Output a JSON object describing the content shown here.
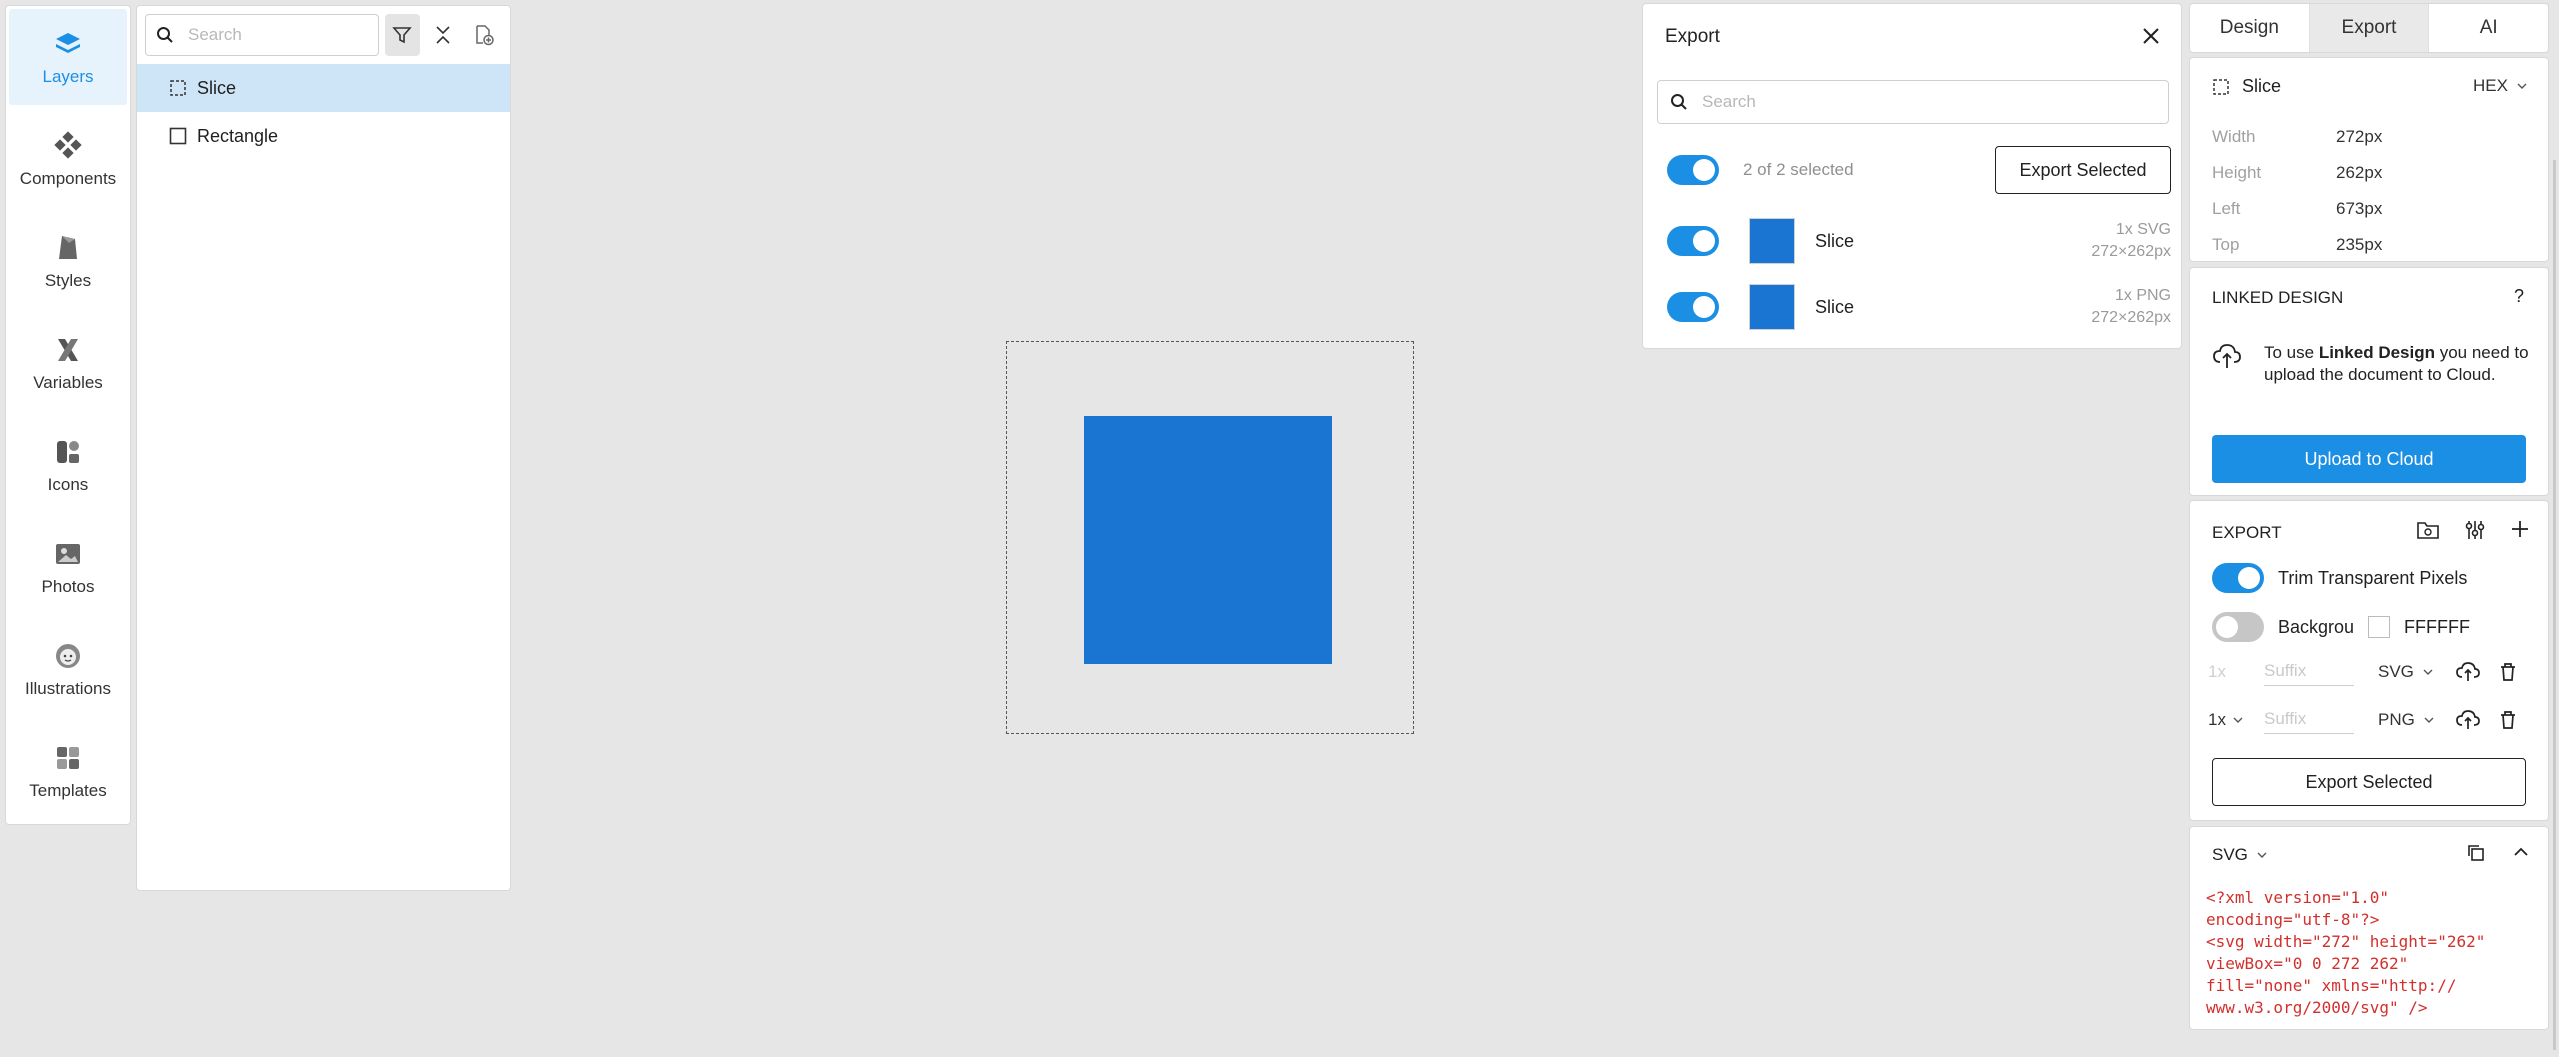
{
  "toolbar": {
    "items": [
      {
        "label": "Layers",
        "icon": "layers-icon"
      },
      {
        "label": "Components",
        "icon": "components-icon"
      },
      {
        "label": "Styles",
        "icon": "styles-icon"
      },
      {
        "label": "Variables",
        "icon": "variables-icon"
      },
      {
        "label": "Icons",
        "icon": "icons-icon"
      },
      {
        "label": "Photos",
        "icon": "photos-icon"
      },
      {
        "label": "Illustrations",
        "icon": "illustrations-icon"
      },
      {
        "label": "Templates",
        "icon": "templates-icon"
      }
    ]
  },
  "layers": {
    "search_placeholder": "Search",
    "items": [
      {
        "name": "Slice",
        "selected": true
      },
      {
        "name": "Rectangle",
        "selected": false
      }
    ]
  },
  "export_popup": {
    "title": "Export",
    "search_placeholder": "Search",
    "selected_count": "2 of 2 selected",
    "export_selected": "Export Selected",
    "items": [
      {
        "name": "Slice",
        "format": "1x SVG",
        "size": "272×262px"
      },
      {
        "name": "Slice",
        "format": "1x PNG",
        "size": "272×262px"
      }
    ]
  },
  "tabs": [
    "Design",
    "Export",
    "AI"
  ],
  "props": {
    "name": "Slice",
    "color_mode": "HEX",
    "rows": [
      {
        "label": "Width",
        "value": "272px"
      },
      {
        "label": "Height",
        "value": "262px"
      },
      {
        "label": "Left",
        "value": "673px"
      },
      {
        "label": "Top",
        "value": "235px"
      }
    ]
  },
  "linked": {
    "title": "LINKED DESIGN",
    "help": "?",
    "msg_prefix": "To use ",
    "msg_bold": "Linked Design",
    "msg_suffix": " you need to upload the document to Cloud.",
    "upload": "Upload to Cloud"
  },
  "export_card": {
    "title": "EXPORT",
    "trim_label": "Trim Transparent Pixels",
    "bg_label": "Backgrou",
    "bg_color": "FFFFFF",
    "rows": [
      {
        "scale": "1x",
        "suffix_placeholder": "Suffix",
        "format": "SVG"
      },
      {
        "scale": "1x",
        "suffix_placeholder": "Suffix",
        "format": "PNG"
      }
    ],
    "export_selected": "Export Selected"
  },
  "svg_card": {
    "format": "SVG",
    "code": "<?xml version=\"1.0\"\nencoding=\"utf-8\"?>\n<svg width=\"272\" height=\"262\"\nviewBox=\"0 0 272 262\"\nfill=\"none\" xmlns=\"http://\nwww.w3.org/2000/svg\" />"
  },
  "colors": {
    "accent": "#1a8fe3",
    "shape_fill": "#1a74d2",
    "selected_row": "#cde5f6",
    "code_text": "#d2302c"
  }
}
